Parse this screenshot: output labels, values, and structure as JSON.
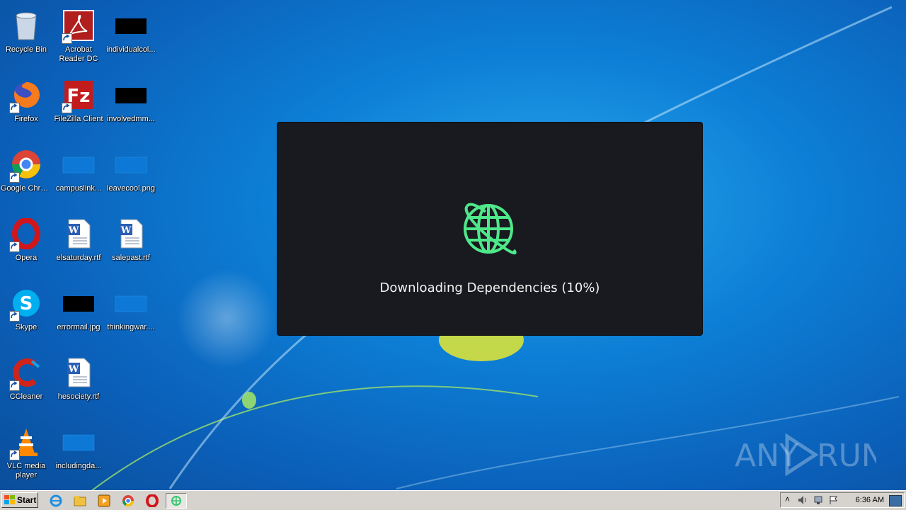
{
  "desktop": {
    "icons": [
      {
        "label": "Recycle Bin"
      },
      {
        "label": "Acrobat Reader DC"
      },
      {
        "label": "individualcol..."
      },
      {
        "label": "Firefox"
      },
      {
        "label": "FileZilla Client"
      },
      {
        "label": "involvedmm..."
      },
      {
        "label": "Google Chrome"
      },
      {
        "label": "campuslink..."
      },
      {
        "label": "leavecool.png"
      },
      {
        "label": "Opera"
      },
      {
        "label": "elsaturday.rtf"
      },
      {
        "label": "salepast.rtf"
      },
      {
        "label": "Skype"
      },
      {
        "label": "errormail.jpg"
      },
      {
        "label": "thinkingwar...."
      },
      {
        "label": "CCleaner"
      },
      {
        "label": "hesociety.rtf"
      },
      {
        "label": "VLC media player"
      },
      {
        "label": "includingda..."
      }
    ]
  },
  "dialog": {
    "status_text": "Downloading Dependencies (10%)",
    "progress": 0.1,
    "icon": "globe-icon",
    "accent_color": "#4ee88a"
  },
  "watermark": {
    "text_left": "ANY",
    "text_right": "RUN"
  },
  "taskbar": {
    "start_label": "Start",
    "apps": [
      "ie-icon",
      "explorer-icon",
      "media-player-icon",
      "chrome-icon",
      "opera-icon",
      "active-app-icon"
    ],
    "clock": "6:36 AM"
  }
}
